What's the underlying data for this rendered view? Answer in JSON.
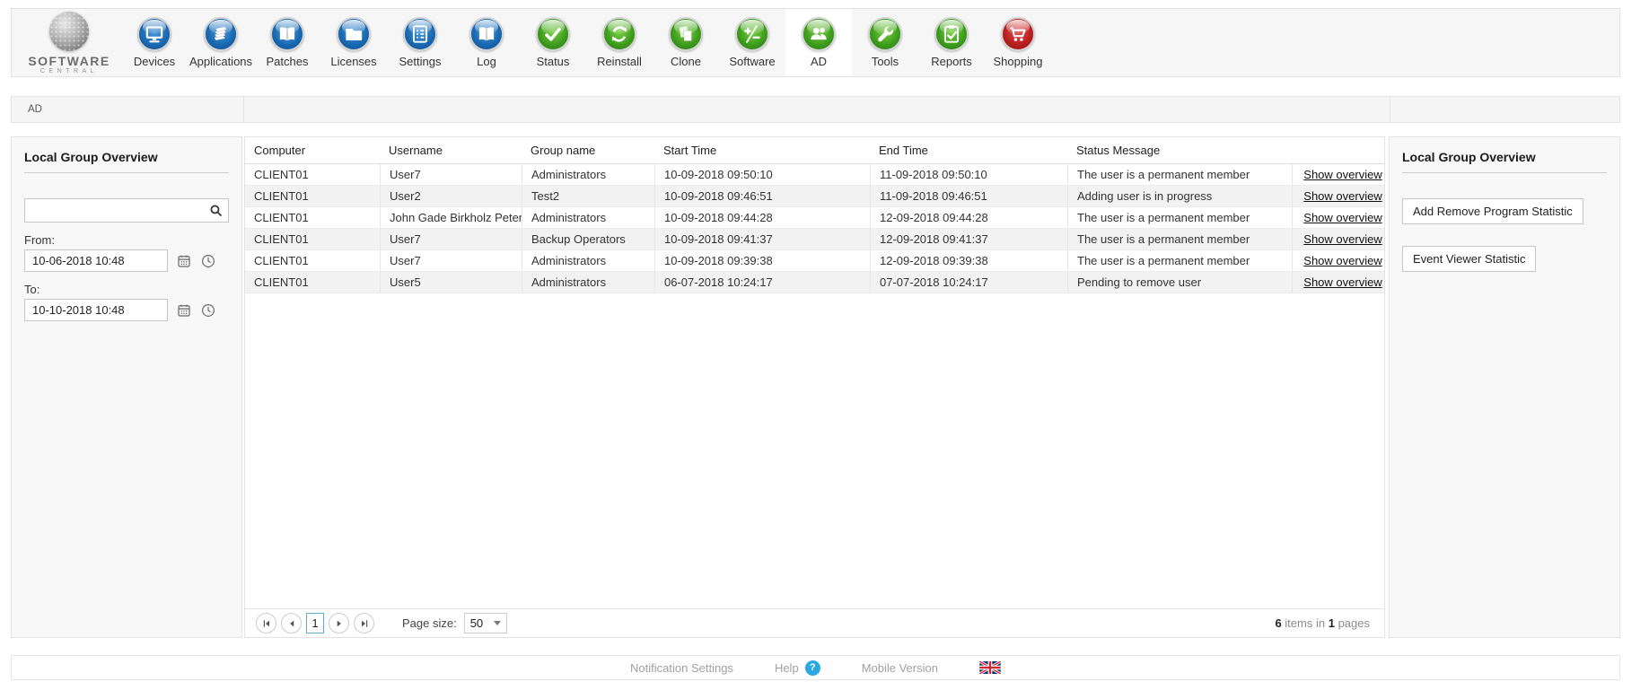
{
  "brand": {
    "name_top": "SOFTWARE",
    "name_bottom": "CENTRAL",
    "logo": "sphere-logo"
  },
  "toolbar": {
    "active_item": "AD",
    "items": [
      {
        "label": "Devices",
        "icon": "monitor-icon",
        "color": "blue"
      },
      {
        "label": "Applications",
        "icon": "stack-icon",
        "color": "blue"
      },
      {
        "label": "Patches",
        "icon": "open-book-icon",
        "color": "blue"
      },
      {
        "label": "Licenses",
        "icon": "folder-icon",
        "color": "blue"
      },
      {
        "label": "Settings",
        "icon": "checklist-icon",
        "color": "blue"
      },
      {
        "label": "Log",
        "icon": "open-book-icon",
        "color": "blue"
      },
      {
        "label": "Status",
        "icon": "checkmark-icon",
        "color": "green"
      },
      {
        "label": "Reinstall",
        "icon": "refresh-icon",
        "color": "green"
      },
      {
        "label": "Clone",
        "icon": "copy-pages-icon",
        "color": "green"
      },
      {
        "label": "Software",
        "icon": "plus-minus-icon",
        "color": "green"
      },
      {
        "label": "AD",
        "icon": "users-icon",
        "color": "green"
      },
      {
        "label": "Tools",
        "icon": "wrench-icon",
        "color": "green"
      },
      {
        "label": "Reports",
        "icon": "report-check-icon",
        "color": "green"
      },
      {
        "label": "Shopping",
        "icon": "cart-icon",
        "color": "red"
      }
    ]
  },
  "breadcrumb": {
    "label": "AD"
  },
  "left_panel": {
    "title": "Local Group Overview",
    "search": {
      "value": "",
      "icon": "search-icon"
    },
    "from_label": "From:",
    "from_value": "10-06-2018 10:48",
    "to_label": "To:",
    "to_value": "10-10-2018 10:48",
    "field_icons": [
      "calendar-icon",
      "clock-icon"
    ]
  },
  "table": {
    "columns": [
      "Computer",
      "Username",
      "Group name",
      "Start Time",
      "End Time",
      "Status Message"
    ],
    "action_label": "Show overview",
    "rows": [
      {
        "computer": "CLIENT01",
        "username": "User7",
        "group": "Administrators",
        "start": "10-09-2018 09:50:10",
        "end": "11-09-2018 09:50:10",
        "status": "The user is a permanent member"
      },
      {
        "computer": "CLIENT01",
        "username": "User2",
        "group": "Test2",
        "start": "10-09-2018 09:46:51",
        "end": "11-09-2018 09:46:51",
        "status": "Adding user is in progress"
      },
      {
        "computer": "CLIENT01",
        "username": "John Gade Birkholz Petersen",
        "group": "Administrators",
        "start": "10-09-2018 09:44:28",
        "end": "12-09-2018 09:44:28",
        "status": "The user is a permanent member"
      },
      {
        "computer": "CLIENT01",
        "username": "User7",
        "group": "Backup Operators",
        "start": "10-09-2018 09:41:37",
        "end": "12-09-2018 09:41:37",
        "status": "The user is a permanent member"
      },
      {
        "computer": "CLIENT01",
        "username": "User7",
        "group": "Administrators",
        "start": "10-09-2018 09:39:38",
        "end": "12-09-2018 09:39:38",
        "status": "The user is a permanent member"
      },
      {
        "computer": "CLIENT01",
        "username": "User5",
        "group": "Administrators",
        "start": "06-07-2018 10:24:17",
        "end": "07-07-2018 10:24:17",
        "status": "Pending to remove user"
      }
    ]
  },
  "pagination": {
    "current_page": "1",
    "page_size_label": "Page size:",
    "page_size_value": "50",
    "summary": {
      "items_count": "6",
      "items_text": "items in",
      "pages_count": "1",
      "pages_text": "pages"
    }
  },
  "right_panel": {
    "title": "Local Group Overview",
    "buttons": [
      {
        "label": "Add Remove Program Statistic"
      },
      {
        "label": "Event Viewer Statistic"
      }
    ]
  },
  "footer": {
    "notification_settings": "Notification Settings",
    "help": "Help",
    "help_badge": "?",
    "mobile_version": "Mobile Version",
    "language_flag": "uk-flag-icon"
  },
  "colors": {
    "icon_blue": "#2e7cc3",
    "icon_green": "#41a32a",
    "icon_red": "#c1272d",
    "help_blue": "#29a9e0",
    "active_page_border": "#5fa8d8",
    "row_alt": "#f2f2f2"
  }
}
